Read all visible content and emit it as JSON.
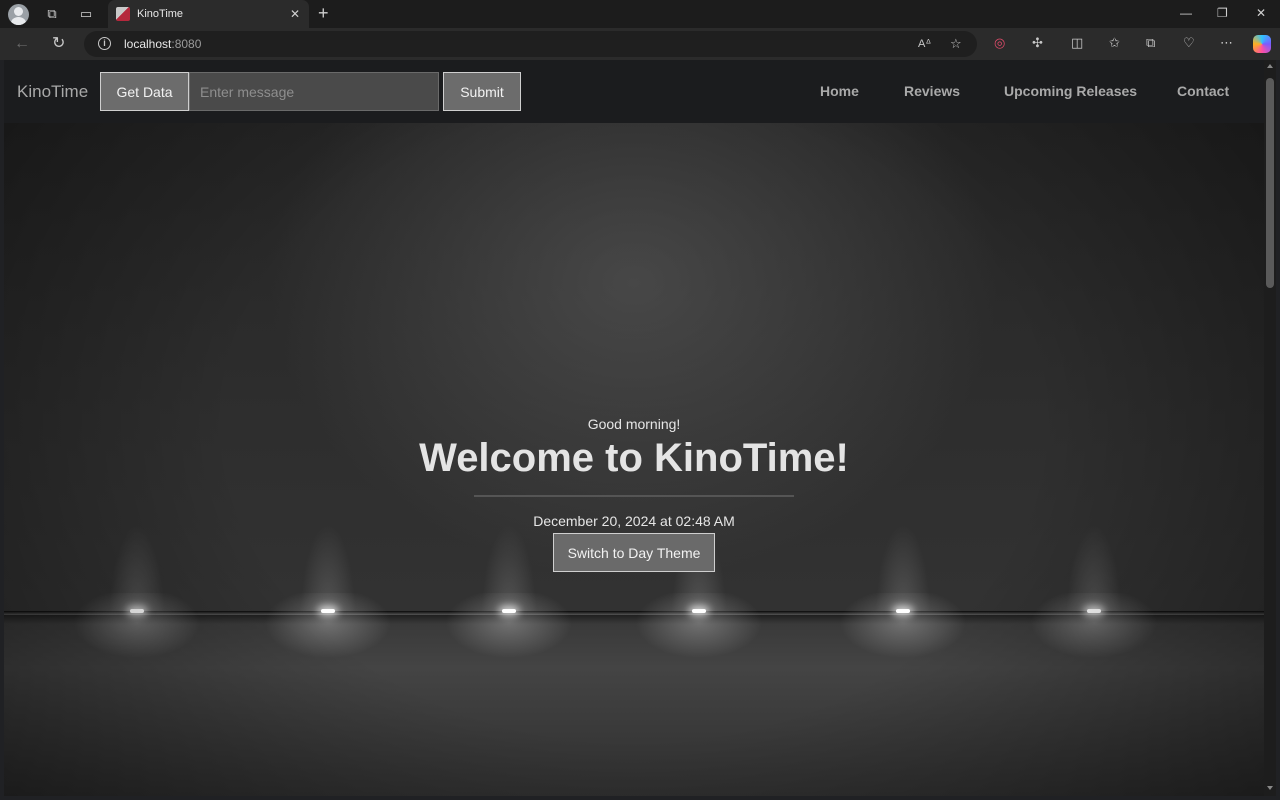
{
  "browser": {
    "tab_title": "KinoTime",
    "url_host": "localhost",
    "url_port": ":8080"
  },
  "site": {
    "brand": "KinoTime",
    "get_data_label": "Get Data",
    "message_placeholder": "Enter message",
    "submit_label": "Submit",
    "nav": [
      {
        "label": "Home"
      },
      {
        "label": "Reviews"
      },
      {
        "label": "Upcoming Releases"
      },
      {
        "label": "Contact"
      }
    ]
  },
  "hero": {
    "greeting": "Good morning!",
    "title": "Welcome to KinoTime!",
    "datetime": "December 20, 2024 at 02:48 AM",
    "theme_button_label": "Switch to Day Theme"
  },
  "colors": {
    "header_bg": "#1b1c1e",
    "button_bg": "#6c6c6c",
    "text_light": "#e4e4e4"
  }
}
